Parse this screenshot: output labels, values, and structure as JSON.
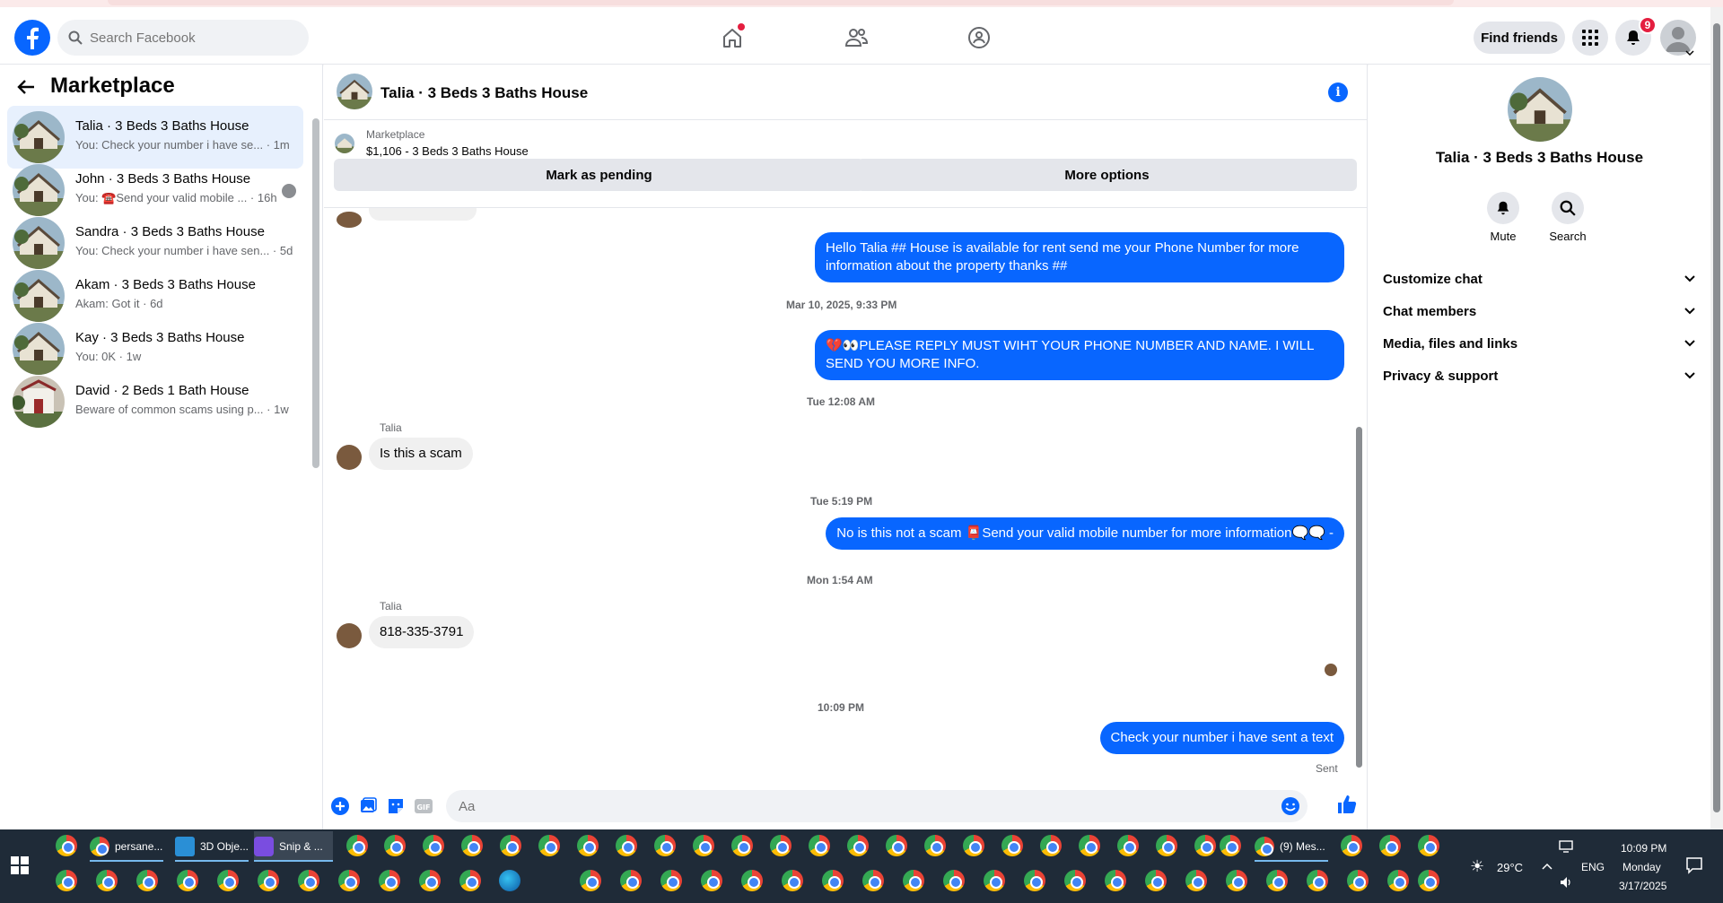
{
  "header": {
    "search_placeholder": "Search Facebook",
    "find_friends": "Find friends",
    "notifications_count": "9"
  },
  "left": {
    "title": "Marketplace",
    "conversations": [
      {
        "name": "Talia · 3 Beds 3 Baths House",
        "sub": "You: Check your number i have se... · 1m",
        "active": true
      },
      {
        "name": "John · 3 Beds 3 Baths House",
        "sub": "You: ☎️Send your valid mobile ... · 16h",
        "active": false
      },
      {
        "name": "Sandra · 3 Beds 3 Baths House",
        "sub": "You: Check your number i have sen... · 5d",
        "active": false
      },
      {
        "name": "Akam · 3 Beds 3 Baths House",
        "sub": "Akam: Got it · 6d",
        "active": false
      },
      {
        "name": "Kay · 3 Beds 3 Baths House",
        "sub": "You: 0K · 1w",
        "active": false
      },
      {
        "name": "David · 2 Beds 1 Bath House",
        "sub": "Beware of common scams using p... · 1w",
        "active": false
      }
    ]
  },
  "chat": {
    "title": "Talia · 3 Beds 3 Baths House",
    "marketplace_label": "Marketplace",
    "listing": "$1,106 - 3 Beds 3 Baths House",
    "mark_pending": "Mark as pending",
    "more_options": "More options",
    "messages": {
      "m1": "Hello Talia ## House is available for rent send me your Phone Number for more information about the property thanks ##",
      "ts1": "Mar 10, 2025, 9:33 PM",
      "m2": "💔👀PLEASE REPLY MUST WIHT YOUR PHONE NUMBER AND NAME. I WILL SEND YOU MORE INFO.",
      "ts2": "Tue 12:08 AM",
      "sender1": "Talia",
      "m3": "Is this a scam",
      "ts3": "Tue 5:19 PM",
      "m4": "No is this not a scam 📮Send your valid mobile number for more information🗨️🗨️ -",
      "ts4": "Mon 1:54 AM",
      "sender2": "Talia",
      "m5": "818-335-3791",
      "ts5": "10:09 PM",
      "m6": "Check your number i have sent a text",
      "status": "Sent"
    },
    "composer_placeholder": "Aa"
  },
  "right": {
    "name": "Talia · 3 Beds 3 Baths House",
    "mute": "Mute",
    "search": "Search",
    "sections": [
      "Customize chat",
      "Chat members",
      "Media, files and links",
      "Privacy & support"
    ]
  },
  "taskbar": {
    "task1": "persane...",
    "task2": "3D Obje...",
    "task3": "Snip & ...",
    "task4": "(9) Mes...",
    "weather": "29°C",
    "lang": "ENG",
    "time": "10:09 PM",
    "day": "Monday",
    "date": "3/17/2025"
  }
}
